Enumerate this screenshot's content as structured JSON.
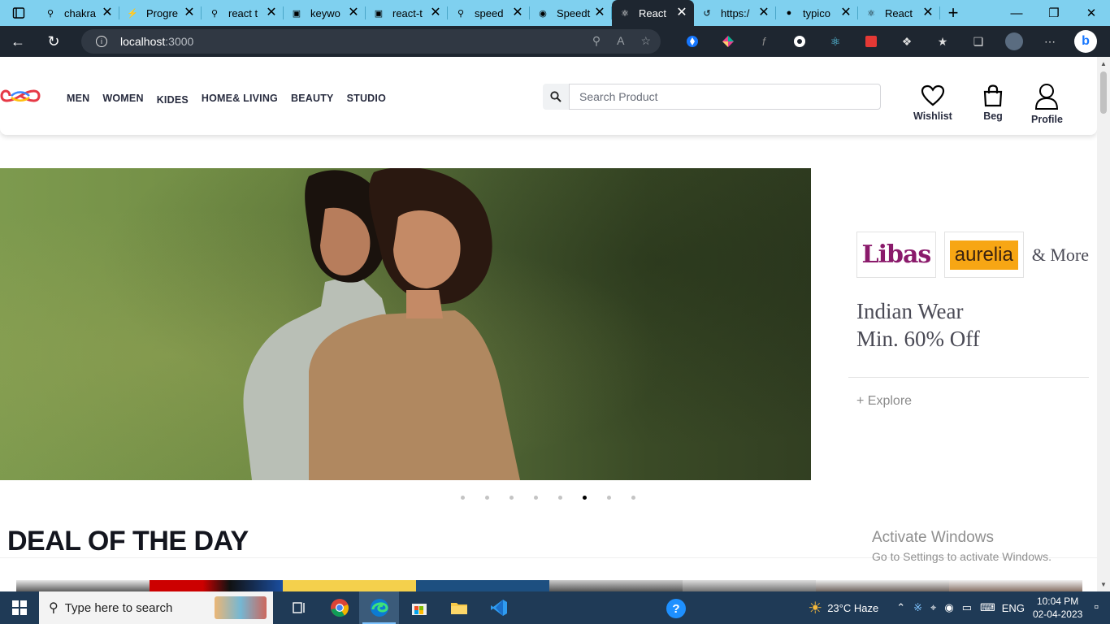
{
  "browser": {
    "tabs": [
      {
        "title": "chakra",
        "icon": "search-icon"
      },
      {
        "title": "Progre",
        "icon": "bolt-icon"
      },
      {
        "title": "react t",
        "icon": "search-icon"
      },
      {
        "title": "keywo",
        "icon": "page-icon"
      },
      {
        "title": "react-t",
        "icon": "page-icon"
      },
      {
        "title": "speed",
        "icon": "search-icon"
      },
      {
        "title": "Speedt",
        "icon": "globe-icon"
      },
      {
        "title": "React",
        "icon": "react-icon"
      },
      {
        "title": "https:/",
        "icon": "loading-icon"
      },
      {
        "title": "typico",
        "icon": "github-icon"
      },
      {
        "title": "React",
        "icon": "react-icon"
      }
    ],
    "active_tab_index": 7,
    "address": {
      "host": "localhost",
      "port": ":3000"
    }
  },
  "site": {
    "nav": [
      "MEN",
      "WOMEN",
      "KIDES",
      "HOME& LIVING",
      "BEAUTY",
      "STUDIO"
    ],
    "search_placeholder": "Search Product",
    "actions": {
      "wishlist": "Wishlist",
      "bag": "Beg",
      "profile": "Profile"
    }
  },
  "hero": {
    "brands": {
      "libas": "Libas",
      "aurelia": "aurelia",
      "more": "& More"
    },
    "title_line1": "Indian Wear",
    "title_line2": "Min. 60% Off",
    "cta": "+ Explore",
    "slide_count": 8,
    "active_slide": 5
  },
  "deal": {
    "title": "DEAL OF THE DAY"
  },
  "watermark": {
    "line1": "Activate Windows",
    "line2": "Go to Settings to activate Windows."
  },
  "taskbar": {
    "search_placeholder": "Type here to search",
    "weather": "23°C  Haze",
    "lang": "ENG",
    "time": "10:04 PM",
    "date": "02-04-2023"
  },
  "colors": {
    "tabstrip": "#7fd0ef",
    "toolbar": "#1e2630",
    "taskbar": "#1f3a56",
    "libas": "#8a1a6b",
    "aurelia": "#f7a614"
  }
}
